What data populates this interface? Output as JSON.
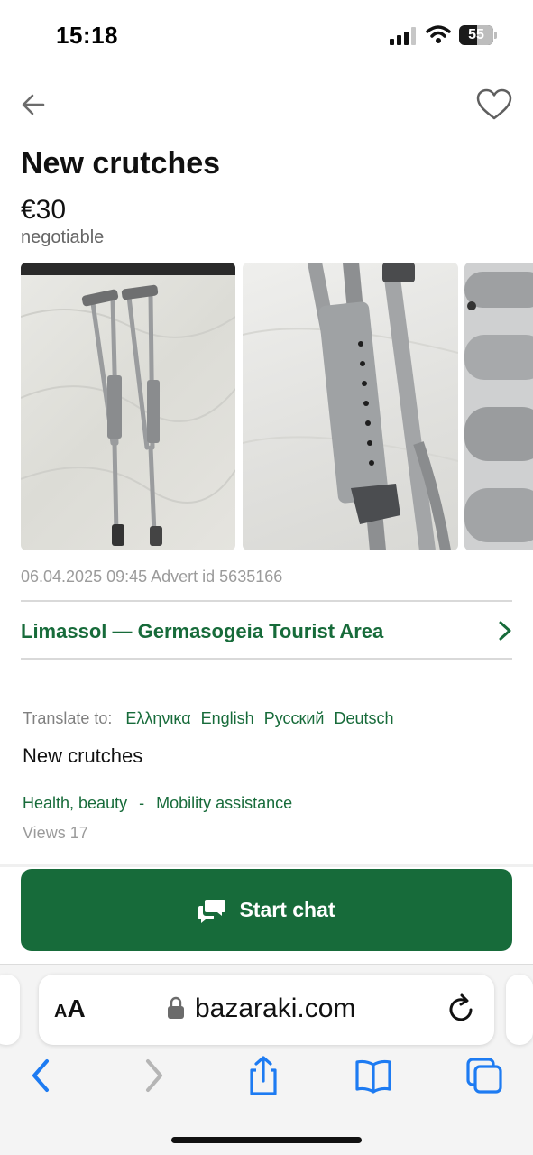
{
  "status_bar": {
    "time": "15:18",
    "battery": "55"
  },
  "listing": {
    "title": "New crutches",
    "price": "€30",
    "price_note": "negotiable",
    "meta": "06.04.2025 09:45 Advert id 5635166",
    "location": "Limassol — Germasogeia Tourist Area",
    "translate_label": "Translate to:",
    "languages": [
      "Ελληνικα",
      "English",
      "Русский",
      "Deutsch"
    ],
    "description": "New crutches",
    "categories": [
      "Health, beauty",
      "Mobility assistance"
    ],
    "category_separator": "-",
    "views": "Views 17"
  },
  "actions": {
    "chat_label": "Start chat"
  },
  "browser": {
    "aa_small": "A",
    "aa_large": "A",
    "url": "bazaraki.com"
  },
  "colors": {
    "accent_green": "#176b3a",
    "ios_blue": "#1d7bf2"
  },
  "icons": [
    "back-arrow-icon",
    "heart-icon",
    "chevron-right-icon",
    "chat-icon",
    "lock-icon",
    "reload-icon",
    "back-icon",
    "forward-icon",
    "share-icon",
    "bookmarks-icon",
    "tabs-icon"
  ]
}
